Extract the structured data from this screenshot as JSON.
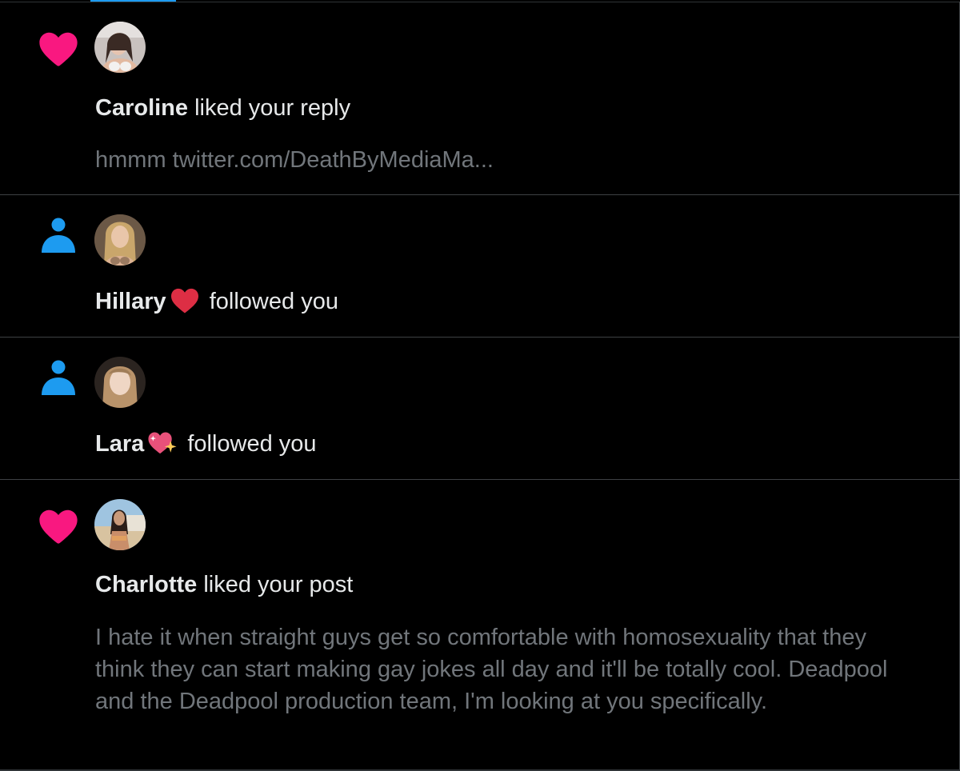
{
  "colors": {
    "background": "#000000",
    "like": "#f91880",
    "follow": "#1d9bf0",
    "text": "#e7e9ea",
    "muted": "#71767b"
  },
  "notifications": [
    {
      "type": "like",
      "icon": "heart-icon",
      "name": "Caroline",
      "action": "liked your reply",
      "preview": "hmmm twitter.com/DeathByMediaMa..."
    },
    {
      "type": "follow",
      "icon": "person-icon",
      "name": "Hillary",
      "name_emoji": "red-heart-emoji",
      "action": "followed you"
    },
    {
      "type": "follow",
      "icon": "person-icon",
      "name": "Lara",
      "name_emoji": "sparkling-heart-emoji",
      "action": "followed you"
    },
    {
      "type": "like",
      "icon": "heart-icon",
      "name": "Charlotte",
      "action": "liked your post",
      "preview": "I hate it when straight guys get so comfortable with homosexuality that they think they can start making gay jokes all day and it'll be totally cool. Deadpool and the Deadpool production team, I'm looking at you specifically."
    }
  ]
}
